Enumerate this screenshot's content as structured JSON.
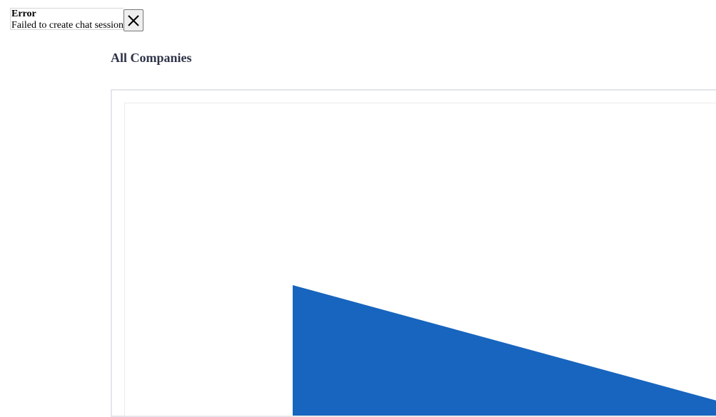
{
  "error": {
    "title": "Error",
    "message": "Failed to create chat session",
    "close_icon": "close-icon"
  },
  "page": {
    "title": "All Companies"
  },
  "colors": {
    "chart_fill": "#1765be",
    "title_text": "#2e3348"
  }
}
